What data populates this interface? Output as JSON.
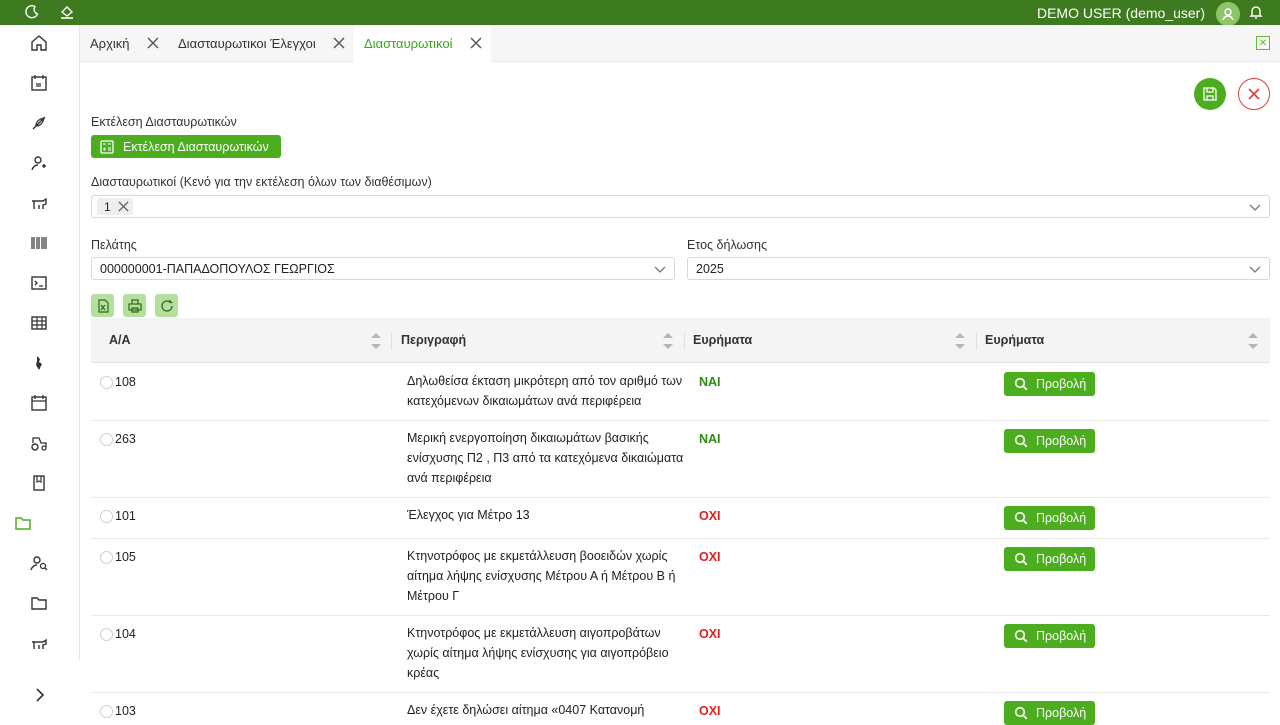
{
  "topbar": {
    "user": "DEMO USER (demo_user)"
  },
  "tabs": [
    {
      "label": "Αρχική"
    },
    {
      "label": "Διασταυρωτικοι Έλεγχοι"
    },
    {
      "label": "Διασταυρωτικοί"
    }
  ],
  "main": {
    "run_section_label": "Εκτέλεση Διασταυρωτικών",
    "run_button_label": "Εκτέλεση Διασταυρωτικών",
    "checks_label": "Διασταυρωτικοί (Κενό για την εκτέλεση όλων των διαθέσιμων)",
    "checks_chip": "1",
    "customer_label": "Πελάτης",
    "customer_value": "000000001-ΠΑΠΑΔΟΠΟΥΛΟΣ ΓΕΩΡΓΙΟΣ",
    "year_label": "Ετος δήλωσης",
    "year_value": "2025"
  },
  "table": {
    "columns": [
      "Α/Α",
      "Περιγραφή",
      "Ευρήματα",
      "Ευρήματα"
    ],
    "view_label": "Προβολή",
    "rows": [
      {
        "id": "108",
        "desc": "Δηλωθείσα έκταση μικρότερη από τον αριθμό των κατεχόμενων δικαιωμάτων ανά περιφέρεια",
        "finding": "ΝΑΙ",
        "status": "yes"
      },
      {
        "id": "263",
        "desc": "Μερική ενεργοποίηση δικαιωμάτων βασικής ενίσχυσης Π2 , Π3 από τα κατεχόμενα δικαιώματα ανά περιφέρεια",
        "finding": "ΝΑΙ",
        "status": "yes"
      },
      {
        "id": "101",
        "desc": "Έλεγχος για Μέτρο 13",
        "finding": "ΟΧΙ",
        "status": "no"
      },
      {
        "id": "105",
        "desc": "Κτηνοτρόφος με εκμετάλλευση βοοειδών χωρίς αίτημα λήψης ενίσχυσης Μέτρου Α ή Μέτρου Β ή Μέτρου Γ",
        "finding": "ΟΧΙ",
        "status": "no"
      },
      {
        "id": "104",
        "desc": "Κτηνοτρόφος με εκμετάλλευση αιγοπροβάτων χωρίς αίτημα λήψης ενίσχυσης για αιγοπρόβειο κρέας",
        "finding": "ΟΧΙ",
        "status": "no"
      },
      {
        "id": "103",
        "desc": "Δεν έχετε δηλώσει αίτημα «0407 Κατανομή",
        "finding": "ΟΧΙ",
        "status": "no"
      }
    ]
  },
  "colors": {
    "brand": "#3e7a1f",
    "accent": "#4cae1f",
    "yes": "#2e8b15",
    "no": "#e02020"
  },
  "icons": [
    "moon-icon",
    "paint-bucket-icon",
    "user-avatar-icon",
    "bell-icon",
    "home-icon",
    "calendar-euro-icon",
    "seedling-icon",
    "user-refresh-icon",
    "livestock-icon",
    "barcode-icon",
    "terminal-icon",
    "table-icon",
    "map-icon",
    "calendar-icon",
    "tractor-icon",
    "book-icon",
    "folder-open-icon",
    "user-search-icon",
    "folder-icon",
    "sheep-icon",
    "chevron-right-icon"
  ]
}
